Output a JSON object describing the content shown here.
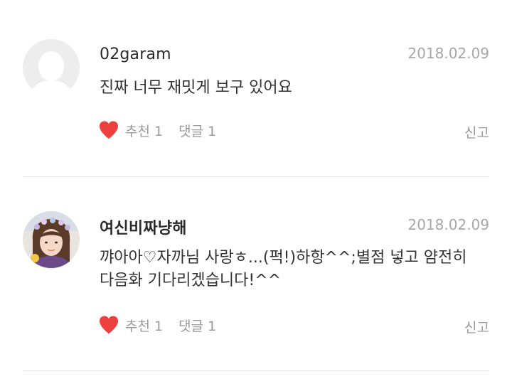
{
  "comments": [
    {
      "username": "02garam",
      "date": "2018.02.09",
      "text": "진짜 너무 재밋게 보구 있어요",
      "avatar_icon": "default-user-icon",
      "like_label": "추천",
      "like_count": "1",
      "reply_label": "댓글",
      "reply_count": "1",
      "report_label": "신고"
    },
    {
      "username": "여신비짜냥해",
      "date": "2018.02.09",
      "text": "꺄아아♡자까님 사랑ㅎ...(퍽!)하항^^;별점 넣고 얌전히 다음화 기다리겠습니다!^^",
      "avatar_icon": "profile-photo",
      "like_label": "추천",
      "like_count": "1",
      "reply_label": "댓글",
      "reply_count": "1",
      "report_label": "신고"
    }
  ],
  "colors": {
    "heart": "#ef4040",
    "meta_text": "#9a9a9a",
    "date_text": "#a7a7a7",
    "divider": "#e6e6e6"
  }
}
